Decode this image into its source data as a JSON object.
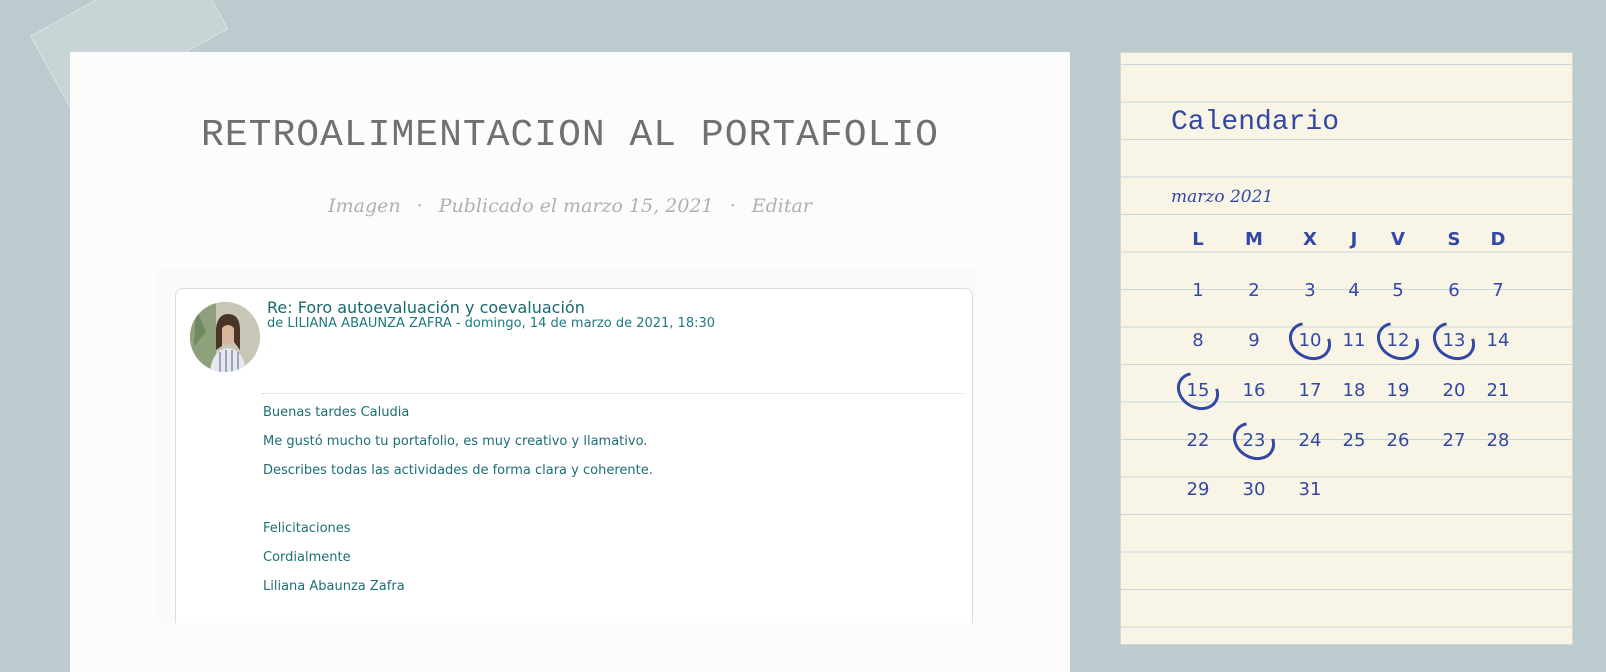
{
  "post": {
    "title": "RETROALIMENTACION AL PORTAFOLIO",
    "meta": {
      "format": "Imagen",
      "separator": "·",
      "published": "Publicado el marzo 15, 2021",
      "edit": "Editar"
    },
    "forum_post": {
      "subject": "Re: Foro autoevaluación y coevaluación",
      "author_line": "de LILIANA ABAUNZA ZAFRA - domingo, 14 de marzo de 2021, 18:30",
      "body": [
        "Buenas tardes Caludia",
        "Me gustó mucho tu portafolio,  es muy creativo y llamativo.",
        "Describes todas las actividades de forma clara y coherente.",
        "",
        "Felicitaciones",
        "Cordialmente",
        "Liliana Abaunza Zafra"
      ]
    }
  },
  "calendar": {
    "heading": "Calendario",
    "month": "marzo 2021",
    "weekdays": [
      "L",
      "M",
      "X",
      "J",
      "V",
      "S",
      "D"
    ],
    "weeks": [
      [
        "1",
        "2",
        "3",
        "4",
        "5",
        "6",
        "7"
      ],
      [
        "8",
        "9",
        "10",
        "11",
        "12",
        "13",
        "14"
      ],
      [
        "15",
        "16",
        "17",
        "18",
        "19",
        "20",
        "21"
      ],
      [
        "22",
        "23",
        "24",
        "25",
        "26",
        "27",
        "28"
      ],
      [
        "29",
        "30",
        "31",
        "",
        "",
        "",
        ""
      ]
    ],
    "days_with_posts": [
      "10",
      "12",
      "13",
      "15",
      "23"
    ],
    "accent_color": "#3248a3"
  }
}
